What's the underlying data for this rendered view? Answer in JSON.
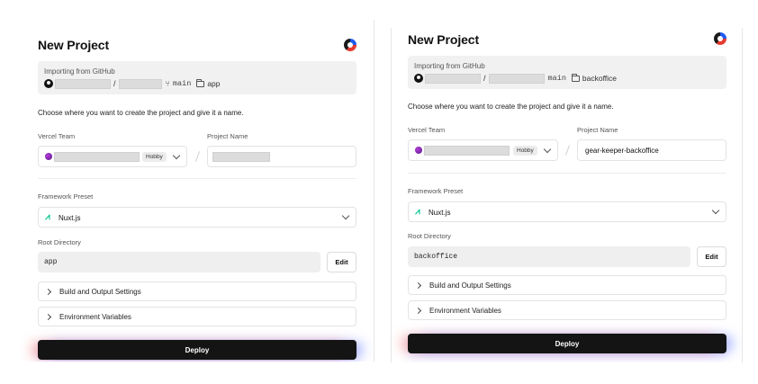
{
  "left": {
    "title": "New Project",
    "import": {
      "label": "Importing from GitHub",
      "separator": "/",
      "branch": "main",
      "directory": "app"
    },
    "choose_text": "Choose where you want to create the project and give it a name.",
    "team_label": "Vercel Team",
    "plan_badge": "Hobby",
    "project_name_label": "Project Name",
    "project_name_value": "",
    "framework_label": "Framework Preset",
    "framework_value": "Nuxt.js",
    "root_label": "Root Directory",
    "root_value": "app",
    "edit_label": "Edit",
    "build_label": "Build and Output Settings",
    "env_label": "Environment Variables",
    "deploy_label": "Deploy"
  },
  "right": {
    "title": "New Project",
    "import": {
      "label": "Importing from GitHub",
      "separator": "/",
      "branch": "main",
      "directory": "backoffice"
    },
    "choose_text": "Choose where you want to create the project and give it a name.",
    "team_label": "Vercel Team",
    "plan_badge": "Hobby",
    "project_name_label": "Project Name",
    "project_name_value": "gear-keeper-backoffice",
    "framework_label": "Framework Preset",
    "framework_value": "Nuxt.js",
    "root_label": "Root Directory",
    "root_value": "backoffice",
    "edit_label": "Edit",
    "build_label": "Build and Output Settings",
    "env_label": "Environment Variables",
    "deploy_label": "Deploy"
  },
  "icons": {
    "brand": "vercel-brand-icon",
    "github": "github-icon",
    "branch": "git-branch-icon",
    "folder": "folder-icon",
    "framework": "nuxt-icon",
    "chevron_down": "chevron-down-icon",
    "chevron_right": "chevron-right-icon"
  },
  "colors": {
    "deploy_bg": "#141414",
    "nuxt_green": "#00c58e",
    "muted_box": "#f1f1f1",
    "team_avatar": "#8a2bc0"
  }
}
